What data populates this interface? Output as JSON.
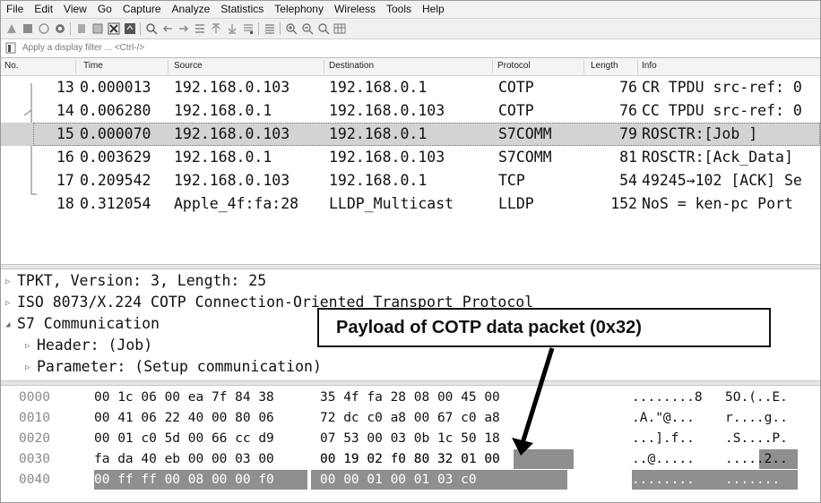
{
  "menu": [
    "File",
    "Edit",
    "View",
    "Go",
    "Capture",
    "Analyze",
    "Statistics",
    "Telephony",
    "Wireless",
    "Tools",
    "Help"
  ],
  "filter": {
    "placeholder": "Apply a display filter ... <Ctrl-/>"
  },
  "columns": [
    "No.",
    "Time",
    "Source",
    "Destination",
    "Protocol",
    "Length",
    "Info"
  ],
  "packets": [
    {
      "no": "13",
      "time": "0.000013",
      "src": "192.168.0.103",
      "dst": "192.168.0.1",
      "proto": "COTP",
      "len": "76",
      "info": "CR TPDU src-ref: 0"
    },
    {
      "no": "14",
      "time": "0.006280",
      "src": "192.168.0.1",
      "dst": "192.168.0.103",
      "proto": "COTP",
      "len": "76",
      "info": "CC TPDU src-ref: 0"
    },
    {
      "no": "15",
      "time": "0.000070",
      "src": "192.168.0.103",
      "dst": "192.168.0.1",
      "proto": "S7COMM",
      "len": "79",
      "info": "ROSCTR:[Job       ]"
    },
    {
      "no": "16",
      "time": "0.003629",
      "src": "192.168.0.1",
      "dst": "192.168.0.103",
      "proto": "S7COMM",
      "len": "81",
      "info": "ROSCTR:[Ack_Data]"
    },
    {
      "no": "17",
      "time": "0.209542",
      "src": "192.168.0.103",
      "dst": "192.168.0.1",
      "proto": "TCP",
      "len": "54",
      "info": "49245→102 [ACK] Se"
    },
    {
      "no": "18",
      "time": "0.312054",
      "src": "Apple_4f:fa:28",
      "dst": "LLDP_Multicast",
      "proto": "LLDP",
      "len": "152",
      "info": "NoS = ken-pc Port"
    }
  ],
  "details": [
    "TPKT, Version: 3, Length: 25",
    "ISO 8073/X.224 COTP Connection-Oriented Transport Protocol",
    "S7 Communication",
    "Header: (Job)",
    "Parameter: (Setup communication)"
  ],
  "hex": [
    {
      "off": "0000",
      "h1": "00 1c 06 00 ea 7f 84 38",
      "h2": "35 4f fa 28 08 00 45 00",
      "a1": "........8",
      "a2": "5O.(..E."
    },
    {
      "off": "0010",
      "h1": "00 41 06 22 40 00 80 06",
      "h2": "72 dc c0 a8 00 67 c0 a8",
      "a1": ".A.\"@...",
      "a2": "r....g.."
    },
    {
      "off": "0020",
      "h1": "00 01 c0 5d 00 66 cc d9",
      "h2": "07 53 00 03 0b 1c 50 18",
      "a1": "...].f..",
      "a2": ".S....P."
    },
    {
      "off": "0030",
      "h1": "fa da 40 eb 00 00 03 00",
      "h2": "00 19 02 f0 80 32 01 00",
      "a1": "..@.....",
      "a2": ".....2.."
    },
    {
      "off": "0040",
      "h1": "00 ff ff 00 08 00 00 f0",
      "h2": "00 00 01 00 01 03 c0",
      "a1": "........",
      "a2": "......."
    }
  ],
  "annotation": "Payload of COTP data packet (0x32)"
}
